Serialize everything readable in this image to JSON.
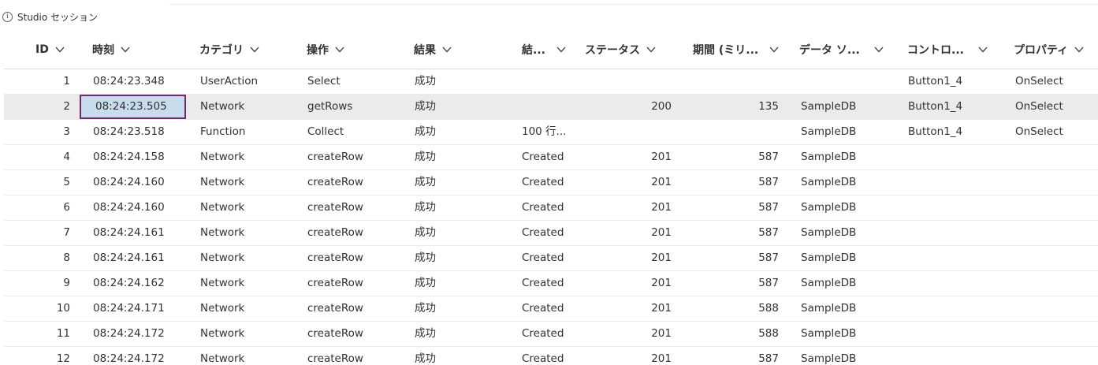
{
  "session": {
    "icon": "info-icon",
    "label": "Studio セッション"
  },
  "columns": [
    {
      "label": "ID"
    },
    {
      "label": "時刻"
    },
    {
      "label": "カテゴリ"
    },
    {
      "label": "操作"
    },
    {
      "label": "結果"
    },
    {
      "label": "結..."
    },
    {
      "label": "ステータス"
    },
    {
      "label": "期間 (ミリ..."
    },
    {
      "label": "データ ソ..."
    },
    {
      "label": "コントロ..."
    },
    {
      "label": "プロパティ"
    }
  ],
  "rows": [
    {
      "id": "1",
      "time": "08:24:23.348",
      "category": "UserAction",
      "operation": "Select",
      "result": "成功",
      "result_info": "",
      "status": "",
      "duration": "",
      "datasource": "",
      "control": "Button1_4",
      "property": "OnSelect"
    },
    {
      "id": "2",
      "time": "08:24:23.505",
      "category": "Network",
      "operation": "getRows",
      "result": "成功",
      "result_info": "",
      "status": "200",
      "duration": "135",
      "datasource": "SampleDB",
      "control": "Button1_4",
      "property": "OnSelect"
    },
    {
      "id": "3",
      "time": "08:24:23.518",
      "category": "Function",
      "operation": "Collect",
      "result": "成功",
      "result_info": "100 行...",
      "status": "",
      "duration": "",
      "datasource": "SampleDB",
      "control": "Button1_4",
      "property": "OnSelect"
    },
    {
      "id": "4",
      "time": "08:24:24.158",
      "category": "Network",
      "operation": "createRow",
      "result": "成功",
      "result_info": "Created",
      "status": "201",
      "duration": "587",
      "datasource": "SampleDB",
      "control": "",
      "property": ""
    },
    {
      "id": "5",
      "time": "08:24:24.160",
      "category": "Network",
      "operation": "createRow",
      "result": "成功",
      "result_info": "Created",
      "status": "201",
      "duration": "587",
      "datasource": "SampleDB",
      "control": "",
      "property": ""
    },
    {
      "id": "6",
      "time": "08:24:24.160",
      "category": "Network",
      "operation": "createRow",
      "result": "成功",
      "result_info": "Created",
      "status": "201",
      "duration": "587",
      "datasource": "SampleDB",
      "control": "",
      "property": ""
    },
    {
      "id": "7",
      "time": "08:24:24.161",
      "category": "Network",
      "operation": "createRow",
      "result": "成功",
      "result_info": "Created",
      "status": "201",
      "duration": "587",
      "datasource": "SampleDB",
      "control": "",
      "property": ""
    },
    {
      "id": "8",
      "time": "08:24:24.161",
      "category": "Network",
      "operation": "createRow",
      "result": "成功",
      "result_info": "Created",
      "status": "201",
      "duration": "587",
      "datasource": "SampleDB",
      "control": "",
      "property": ""
    },
    {
      "id": "9",
      "time": "08:24:24.162",
      "category": "Network",
      "operation": "createRow",
      "result": "成功",
      "result_info": "Created",
      "status": "201",
      "duration": "587",
      "datasource": "SampleDB",
      "control": "",
      "property": ""
    },
    {
      "id": "10",
      "time": "08:24:24.171",
      "category": "Network",
      "operation": "createRow",
      "result": "成功",
      "result_info": "Created",
      "status": "201",
      "duration": "588",
      "datasource": "SampleDB",
      "control": "",
      "property": ""
    },
    {
      "id": "11",
      "time": "08:24:24.172",
      "category": "Network",
      "operation": "createRow",
      "result": "成功",
      "result_info": "Created",
      "status": "201",
      "duration": "588",
      "datasource": "SampleDB",
      "control": "",
      "property": ""
    },
    {
      "id": "12",
      "time": "08:24:24.172",
      "category": "Network",
      "operation": "createRow",
      "result": "成功",
      "result_info": "Created",
      "status": "201",
      "duration": "587",
      "datasource": "SampleDB",
      "control": "",
      "property": ""
    }
  ],
  "selected_row": 1,
  "colors": {
    "selected_row_bg": "#edebe9",
    "focus_cell_bg": "#c7dcec",
    "focus_border": "#6b2c6b"
  }
}
